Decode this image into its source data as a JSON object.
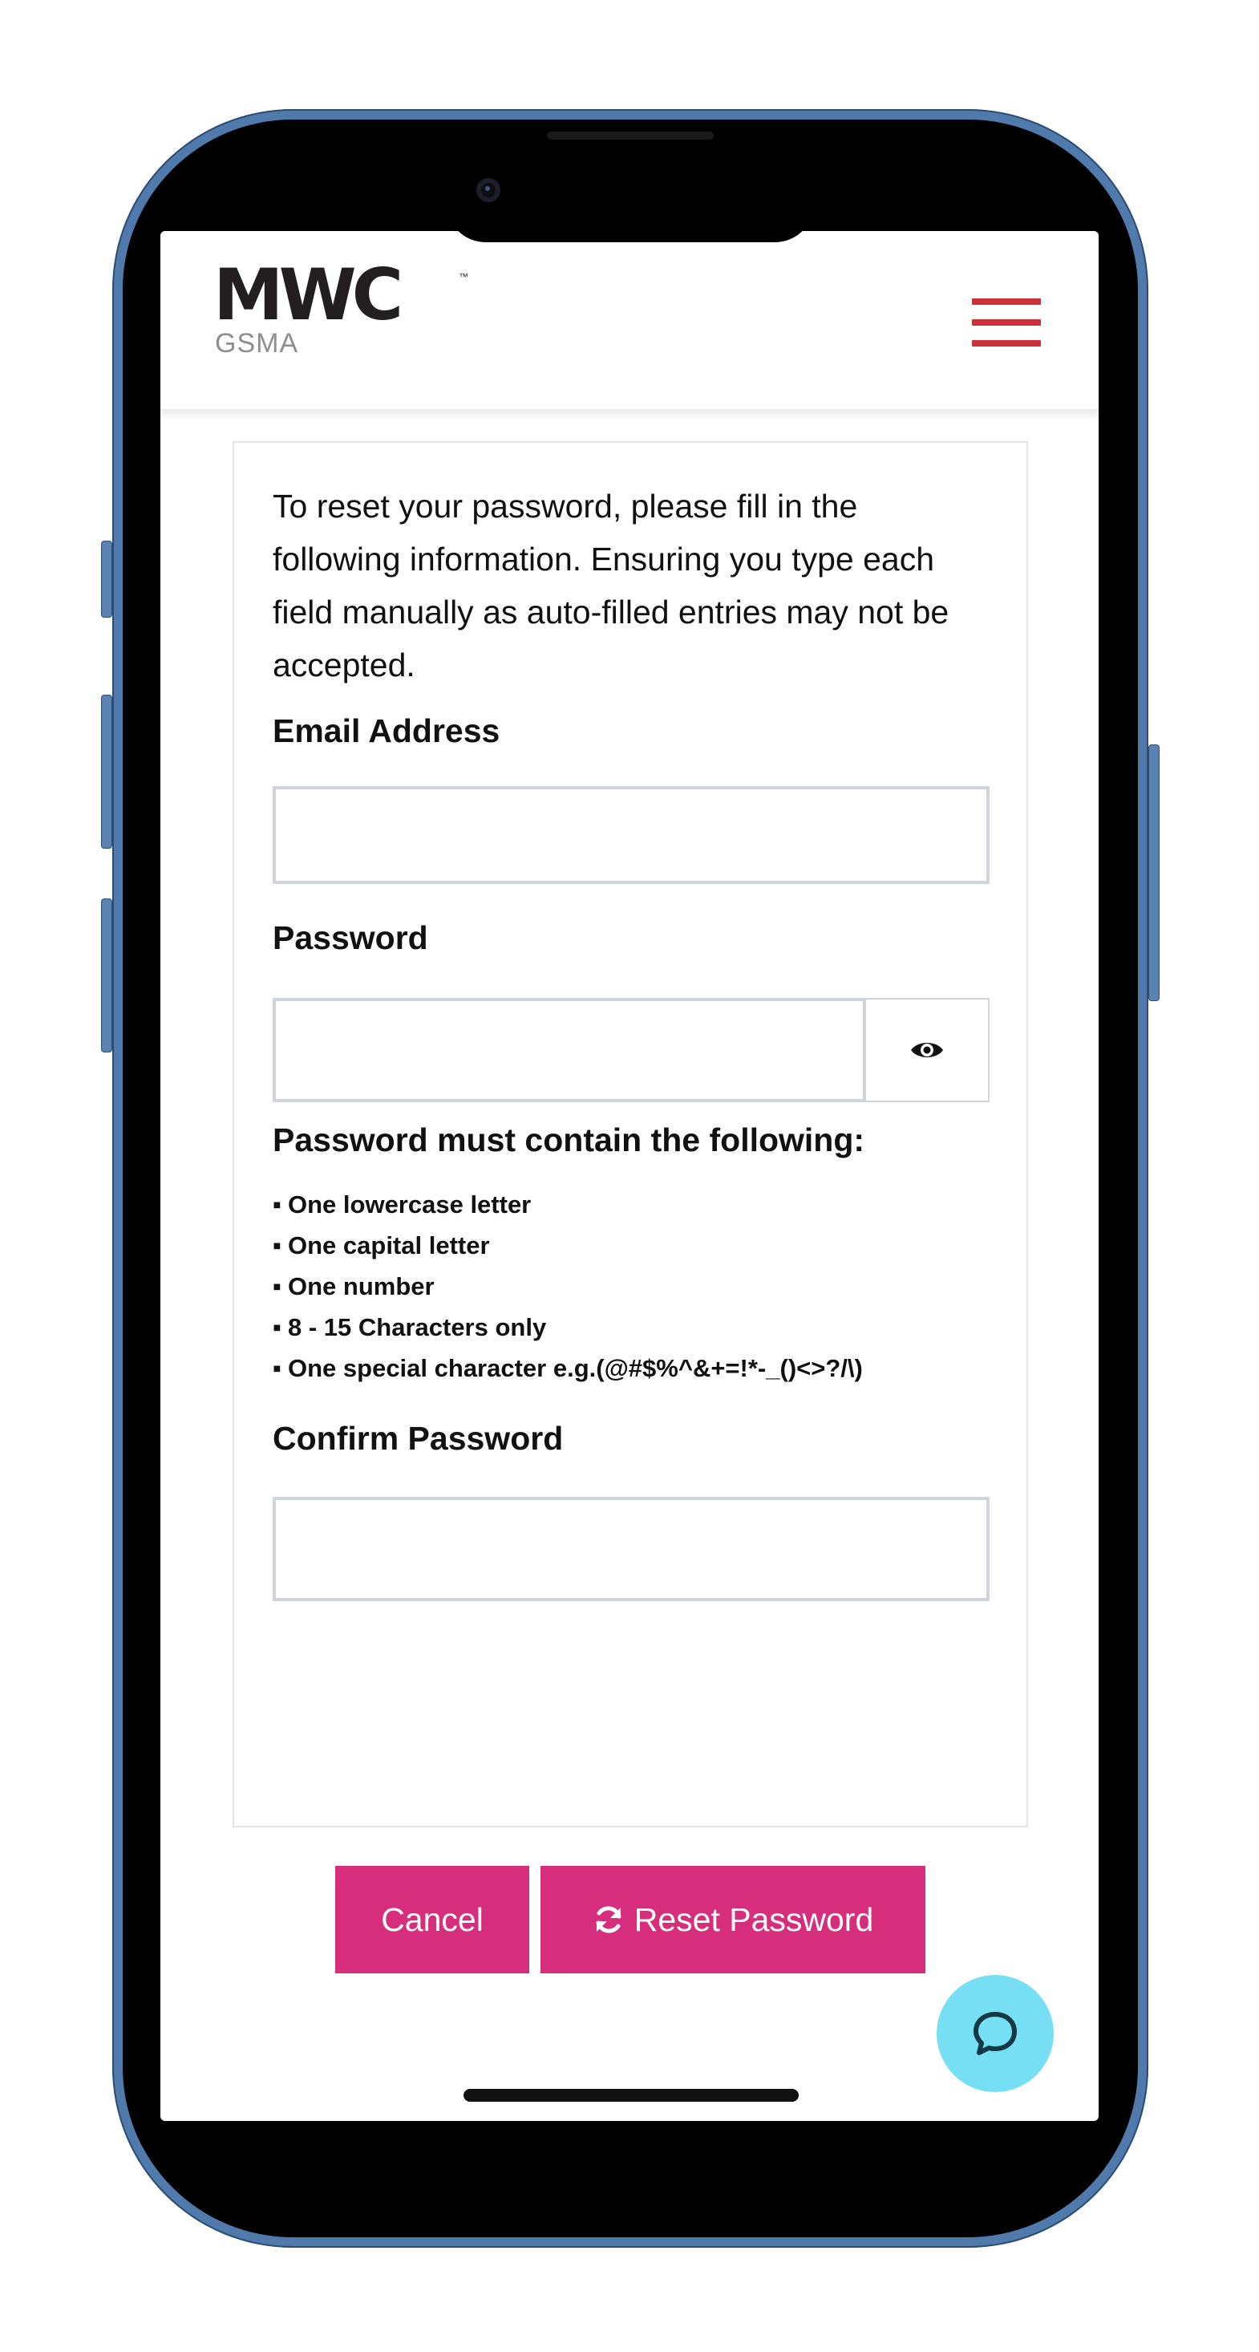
{
  "header": {
    "logo_main": "MWC",
    "logo_trademark": "™",
    "logo_sub": "GSMA",
    "menu_icon": "hamburger-menu-icon",
    "menu_color": "#c8333a"
  },
  "form": {
    "intro": "To reset your password, please fill in the following information. Ensuring you type each field manually as auto-filled entries may not be accepted.",
    "email_label": "Email Address",
    "email_value": "",
    "password_label": "Password",
    "password_value": "",
    "show_password_icon": "eye-icon",
    "requirements_title": "Password must contain the following:",
    "requirements": [
      "One lowercase letter",
      "One capital letter",
      "One number",
      "8 - 15 Characters only",
      "One special character e.g.(@#$%^&+=!*-_()<>?/\\)"
    ],
    "confirm_label": "Confirm Password",
    "confirm_value": "",
    "cancel_label": "Cancel",
    "reset_label": "Reset Password",
    "reset_icon": "refresh-icon",
    "button_color": "#d62e7d"
  },
  "chat": {
    "icon": "chat-bubble-icon",
    "color": "#76dff3"
  }
}
